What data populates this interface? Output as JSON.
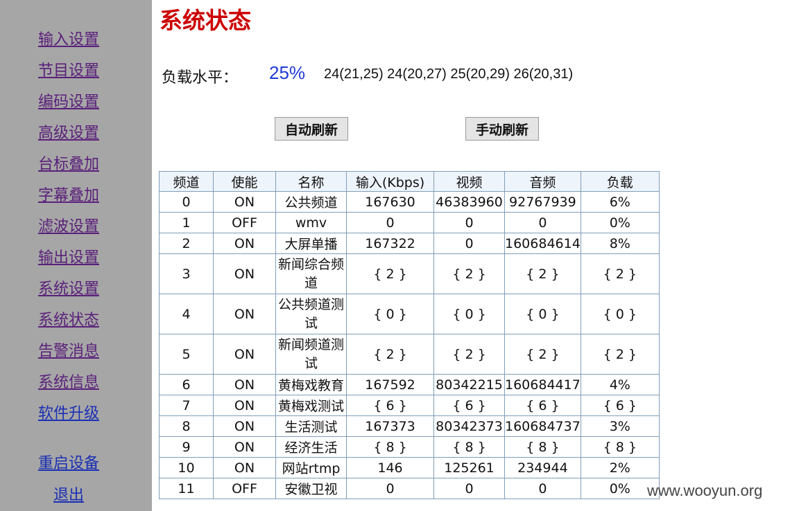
{
  "sidebar": {
    "items": [
      {
        "label": "输入设置"
      },
      {
        "label": "节目设置"
      },
      {
        "label": "编码设置"
      },
      {
        "label": "高级设置"
      },
      {
        "label": "台标叠加"
      },
      {
        "label": "字幕叠加"
      },
      {
        "label": "滤波设置"
      },
      {
        "label": "输出设置"
      },
      {
        "label": "系统设置"
      },
      {
        "label": "系统状态"
      },
      {
        "label": "告警消息"
      },
      {
        "label": "系统信息"
      },
      {
        "label": "软件升级"
      },
      {
        "label": "重启设备"
      },
      {
        "label": "退出"
      }
    ]
  },
  "page": {
    "title": "系统状态",
    "load_label": "负载水平：",
    "load_percent": "25%",
    "load_history": "24(21,25) 24(20,27) 25(20,29) 26(20,31)"
  },
  "buttons": {
    "auto_refresh": "自动刷新",
    "manual_refresh": "手动刷新"
  },
  "table": {
    "headers": [
      "频道",
      "使能",
      "名称",
      "输入(Kbps)",
      "视频",
      "音频",
      "负载"
    ],
    "rows": [
      [
        "0",
        "ON",
        "公共频道",
        "167630",
        "46383960",
        "92767939",
        "6%"
      ],
      [
        "1",
        "OFF",
        "wmv",
        "0",
        "0",
        "0",
        "0%"
      ],
      [
        "2",
        "ON",
        "大屏单播",
        "167322",
        "0",
        "160684614",
        "8%"
      ],
      [
        "3",
        "ON",
        "新闻综合频道",
        "{ 2 }",
        "{ 2 }",
        "{ 2 }",
        "{ 2 }"
      ],
      [
        "4",
        "ON",
        "公共频道测试",
        "{ 0 }",
        "{ 0 }",
        "{ 0 }",
        "{ 0 }"
      ],
      [
        "5",
        "ON",
        "新闻频道测试",
        "{ 2 }",
        "{ 2 }",
        "{ 2 }",
        "{ 2 }"
      ],
      [
        "6",
        "ON",
        "黄梅戏教育",
        "167592",
        "80342215",
        "160684417",
        "4%"
      ],
      [
        "7",
        "ON",
        "黄梅戏测试",
        "{ 6 }",
        "{ 6 }",
        "{ 6 }",
        "{ 6 }"
      ],
      [
        "8",
        "ON",
        "生活测试",
        "167373",
        "80342373",
        "160684737",
        "3%"
      ],
      [
        "9",
        "ON",
        "经济生活",
        "{ 8 }",
        "{ 8 }",
        "{ 8 }",
        "{ 8 }"
      ],
      [
        "10",
        "ON",
        "网站rtmp",
        "146",
        "125261",
        "234944",
        "2%"
      ],
      [
        "11",
        "OFF",
        "安徽卫视",
        "0",
        "0",
        "0",
        "0%"
      ]
    ]
  },
  "watermark": "www.wooyun.org",
  "colors": {
    "sidebar_bg": "#a6a6a6",
    "nav_link": "#5a1f7a",
    "nav_link_active": "#1a2fb4",
    "title": "#cc0000",
    "load_percent": "#1f39d6",
    "table_header_bg": "#eef4fb",
    "table_border": "#7f9db9"
  }
}
